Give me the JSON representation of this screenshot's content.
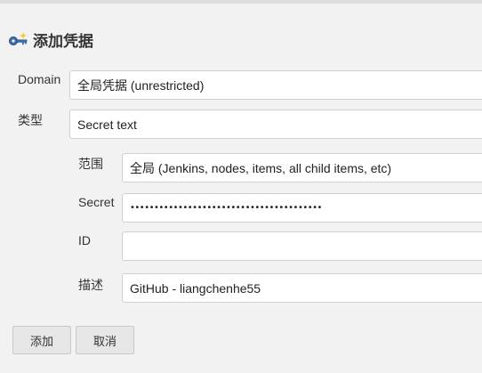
{
  "page": {
    "title": "添加凭据"
  },
  "form": {
    "domain": {
      "label": "Domain",
      "value": "全局凭据 (unrestricted)"
    },
    "kind": {
      "label": "类型",
      "value": "Secret text"
    },
    "scope": {
      "label": "范围",
      "value": "全局 (Jenkins, nodes, items, all child items, etc)"
    },
    "secret": {
      "label": "Secret",
      "value": "••••••••••••••••••••••••••••••••••••••••"
    },
    "id": {
      "label": "ID",
      "value": ""
    },
    "description": {
      "label": "描述",
      "value": "GitHub - liangchenhe55"
    }
  },
  "buttons": {
    "add": "添加",
    "cancel": "取消"
  },
  "icons": {
    "title_icon": "key-icon"
  }
}
